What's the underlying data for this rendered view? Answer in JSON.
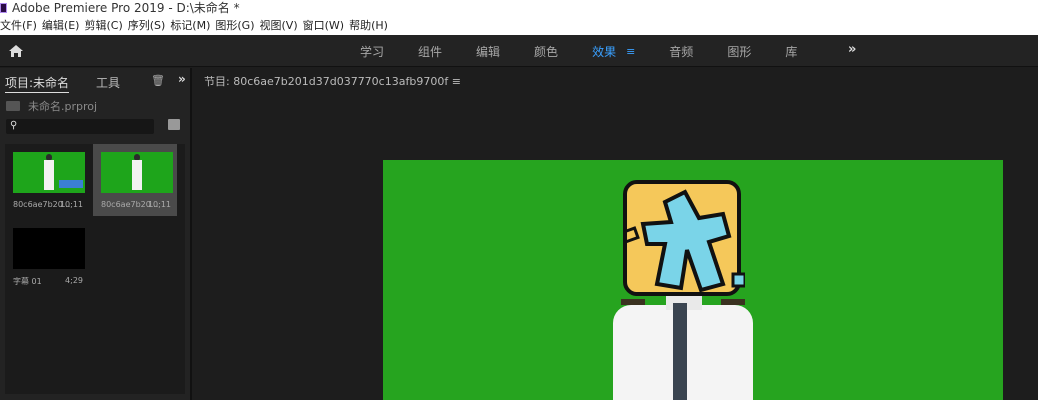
{
  "window": {
    "title": "Adobe Premiere Pro 2019 - D:\\未命名 *"
  },
  "menu": [
    "文件(F)",
    "编辑(E)",
    "剪辑(C)",
    "序列(S)",
    "标记(M)",
    "图形(G)",
    "视图(V)",
    "窗口(W)",
    "帮助(H)"
  ],
  "workspaces": {
    "tabs": [
      "学习",
      "组件",
      "编辑",
      "颜色",
      "效果",
      "音频",
      "图形",
      "库"
    ],
    "active": "效果",
    "more_icon": "»"
  },
  "project_panel": {
    "tab_project": "项目:未命名",
    "tab_tools": "工具",
    "project_file": "未命名.prproj",
    "items": [
      {
        "name": "80c6ae7b20...",
        "duration": "10;11"
      },
      {
        "name": "80c6ae7b20...",
        "duration": "10;11"
      },
      {
        "name": "字幕 01",
        "duration": "4;29"
      }
    ]
  },
  "sequence": {
    "title": "节目: 80c6ae7b201d37d037770c13afb9700f ≡"
  },
  "colors": {
    "accent": "#3aa0ff",
    "green_screen": "#26a41f"
  }
}
